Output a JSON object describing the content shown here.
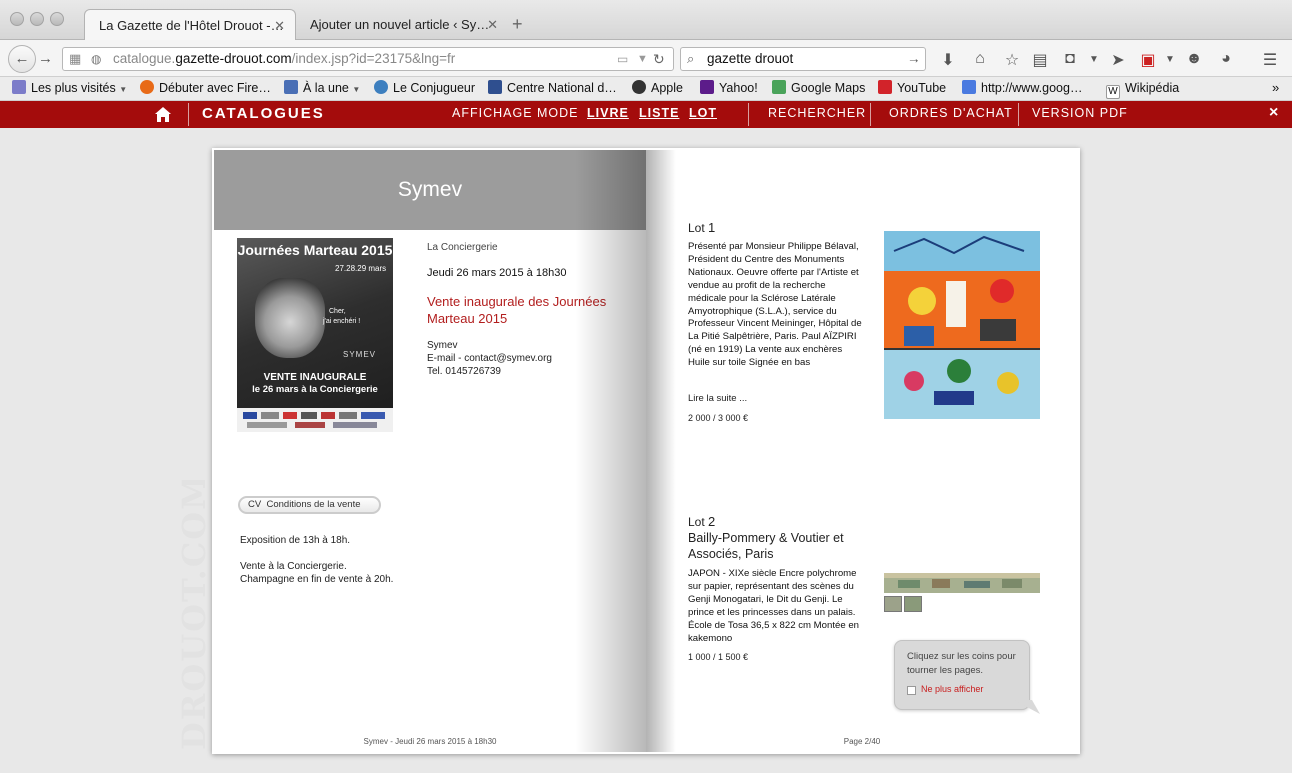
{
  "browser": {
    "tabs": [
      {
        "title": "La Gazette de l'Hôtel Drouot -…"
      },
      {
        "title": "Ajouter un nouvel article ‹ Sy…"
      }
    ],
    "url_prefix": "catalogue.",
    "url_domain": "gazette-drouot.com",
    "url_path": "/index.jsp?id=23175&lng=fr",
    "search_value": "gazette drouot"
  },
  "bookmarks": [
    {
      "label": "Les plus visités",
      "icon": "folder-icon",
      "dropdown": true
    },
    {
      "label": "Débuter avec Fire…",
      "icon": "firefox-icon"
    },
    {
      "label": "À la une",
      "icon": "rss-icon",
      "dropdown": true
    },
    {
      "label": "Le Conjugueur",
      "icon": "conjugueur-icon"
    },
    {
      "label": "Centre National d…",
      "icon": "cnrtl-icon"
    },
    {
      "label": "Apple",
      "icon": "apple-icon"
    },
    {
      "label": "Yahoo!",
      "icon": "yahoo-icon"
    },
    {
      "label": "Google Maps",
      "icon": "google-maps-icon"
    },
    {
      "label": "YouTube",
      "icon": "youtube-icon"
    },
    {
      "label": "http://www.goog…",
      "icon": "google-icon"
    },
    {
      "label": "Wikipédia",
      "icon": "wikipedia-icon"
    }
  ],
  "site": {
    "brand": "CATALOGUES",
    "affichage": "AFFICHAGE MODE",
    "mode_livre": "LIVRE",
    "mode_liste": "LISTE",
    "mode_lot": "LOT",
    "rechercher": "RECHERCHER",
    "ordres": "ORDRES D'ACHAT",
    "pdf": "VERSION PDF",
    "close": "×"
  },
  "left_page": {
    "header": "Symev",
    "poster": {
      "title": "Journées Marteau 2015",
      "dates": "27.28.29 mars",
      "quote1": "Cher,",
      "quote2": "j'ai enchéri !",
      "brand": "SYMEV",
      "line1": "VENTE INAUGURALE",
      "line2": "le 26 mars à la Conciergerie"
    },
    "venue": "La Conciergerie",
    "date": "Jeudi 26 mars 2015 à 18h30",
    "sale_title": "Vente inaugurale des Journées Marteau 2015",
    "contact_name": "Symev",
    "contact_email": "E-mail - contact@symev.org",
    "contact_tel": "Tel. 0145726739",
    "cv_badge": "CV",
    "conditions": "Conditions de la vente",
    "exposition": "Exposition de 13h à 18h.",
    "vente_line1": "Vente à la Conciergerie.",
    "vente_line2": "Champagne en fin de vente à 20h.",
    "watermark": "DROUOT.COM",
    "footer": "Symev - Jeudi 26 mars 2015 à 18h30"
  },
  "right_page": {
    "lots": [
      {
        "lot_word": "Lot",
        "lot_num": "1",
        "subtitle": "",
        "description": "Présenté par Monsieur Philippe Bélaval, Président du Centre des Monuments Nationaux. Oeuvre offerte par l'Artiste et vendue au profit de la recherche médicale pour la Sclérose Latérale Amyotrophique (S.L.A.), service du Professeur Vincent Meininger, Hôpital de La Pitié Salpêtrière, Paris. Paul AÏZPIRI (né en 1919) La vente aux enchères Huile sur toile Signée en bas",
        "more": "Lire la suite ...",
        "estimate": "2 000 / 3 000 €"
      },
      {
        "lot_word": "Lot",
        "lot_num": "2",
        "subtitle": "Bailly-Pommery & Voutier et Associés, Paris",
        "description": "JAPON - XIXe siècle Encre polychrome sur papier, représentant des scènes du Genji Monogatari, le Dit du Genji. Le prince et les princesses dans un palais. École de Tosa 36,5 x 822 cm Montée en kakemono",
        "estimate": "1 000 / 1 500 €"
      }
    ],
    "tooltip_text": "Cliquez sur les coins pour tourner les pages.",
    "tooltip_checkbox": "Ne plus afficher",
    "footer": "Page 2/40"
  },
  "colors": {
    "brand_red": "#a40c0c",
    "title_red": "#b21e1e"
  }
}
